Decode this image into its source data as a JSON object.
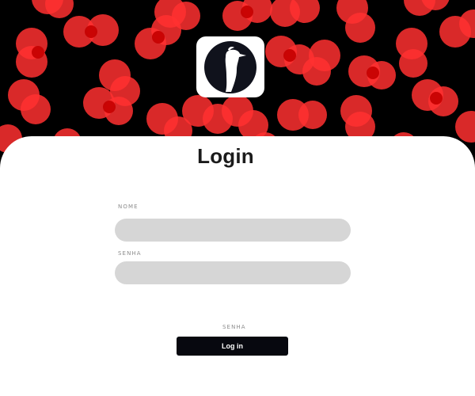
{
  "colors": {
    "accent_red": "#ff3b3b",
    "deep_red": "#e60000",
    "button_dark": "#07080f",
    "field_fill": "#d6d6d6"
  },
  "logo": {
    "icon": "woodpecker-silhouette-icon"
  },
  "page": {
    "title": "Login"
  },
  "form": {
    "name_label": "NOME",
    "name_value": "",
    "password_label": "SENHA",
    "password_value": "",
    "helper_label": "SENHA",
    "submit_label": "Log in"
  }
}
